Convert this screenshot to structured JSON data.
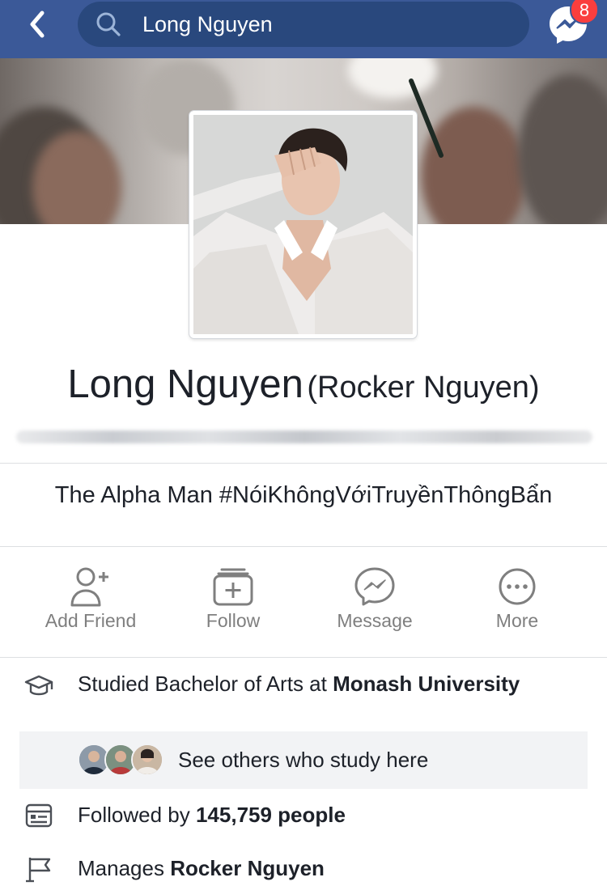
{
  "header": {
    "search_value": "Long Nguyen",
    "messenger_badge": "8",
    "brand_color": "#3b5998"
  },
  "profile": {
    "name": "Long Nguyen",
    "alternate_name": "(Rocker Nguyen)",
    "bio": "The Alpha Man #NóiKhôngVớiTruyềnThôngBẩn"
  },
  "actions": [
    {
      "label": "Add Friend",
      "icon": "add-friend-icon"
    },
    {
      "label": "Follow",
      "icon": "follow-icon"
    },
    {
      "label": "Message",
      "icon": "messenger-icon"
    },
    {
      "label": "More",
      "icon": "more-icon"
    }
  ],
  "intro": {
    "education_prefix": "Studied Bachelor of Arts at ",
    "education_school": "Monash University",
    "see_others": "See others who study here",
    "followers_prefix": "Followed by ",
    "followers_count": "145,759 people",
    "manages_prefix": "Manages ",
    "manages_page": "Rocker Nguyen"
  }
}
